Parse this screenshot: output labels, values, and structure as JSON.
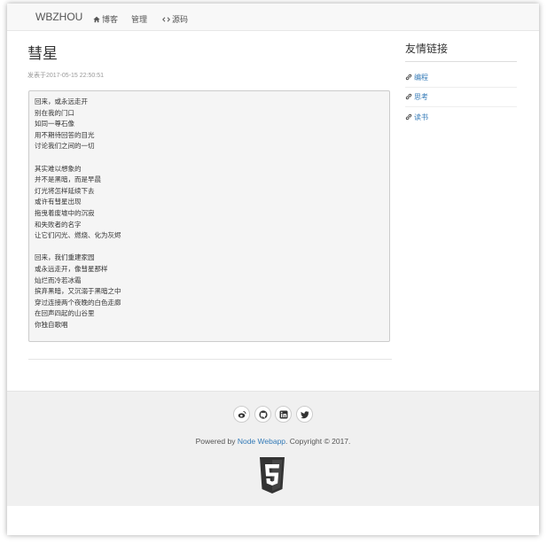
{
  "navbar": {
    "brand": "WBZHOU",
    "links": [
      {
        "label": "博客",
        "icon": "home-icon"
      },
      {
        "label": "管理"
      },
      {
        "label": "源码",
        "icon": "code-icon"
      }
    ]
  },
  "post": {
    "title": "彗星",
    "meta": "发表于2017-05-15 22:50:51",
    "stanzas": [
      [
        "回来，或永远走开",
        "别在我的门口",
        "如同一尊石像",
        "用不期待回答的目光",
        "讨论我们之间的一切"
      ],
      [
        "其实难以想象的",
        "并不是黑暗，而是早晨",
        "灯光将怎样延续下去",
        "或许有彗星出现",
        "拖曳着废墟中的沉寂",
        "和失败者的名字",
        "让它们闪光、燃烧、化为灰烬"
      ],
      [
        "回来，我们重建家园",
        "或永远走开，像彗星那样",
        "灿烂而冷若冰霜",
        "摈弃黑暗，又沉溺于黑暗之中",
        "穿过连接两个夜晚的白色走廊",
        "在回声四起的山谷里",
        "你独自歌唱"
      ]
    ]
  },
  "sidebar": {
    "title": "友情链接",
    "links": [
      {
        "label": "编程",
        "icon": "link-icon"
      },
      {
        "label": "思考",
        "icon": "link-icon"
      },
      {
        "label": "读书",
        "icon": "link-icon"
      }
    ]
  },
  "footer": {
    "social": [
      {
        "name": "weibo-icon"
      },
      {
        "name": "github-icon"
      },
      {
        "name": "linkedin-icon"
      },
      {
        "name": "twitter-icon"
      }
    ],
    "powered_prefix": "Powered by ",
    "powered_link": "Node Webapp",
    "powered_suffix": ". Copyright © 2017.",
    "badge_icon": "html5-icon"
  },
  "colors": {
    "link": "#337ab7",
    "navbar_bg": "#f8f8f8",
    "footer_bg": "#f0f0f0",
    "pre_bg": "#f5f5f5"
  }
}
